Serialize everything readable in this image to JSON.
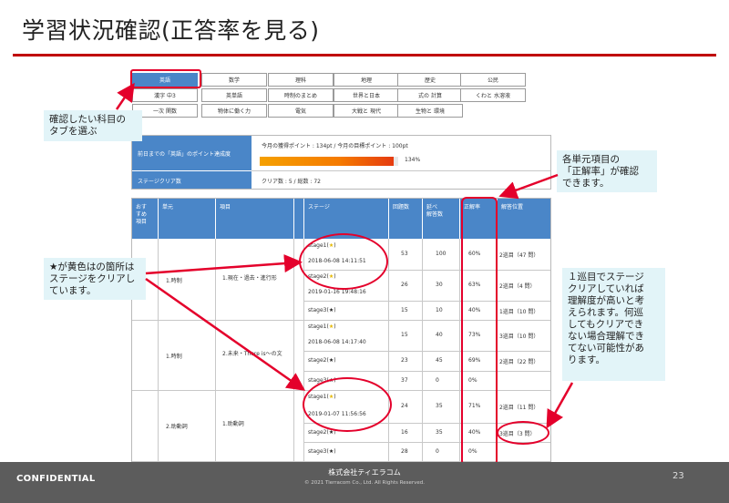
{
  "slide": {
    "title": "学習状況確認(正答率を見る)",
    "confidential": "CONFIDENTIAL",
    "company": "株式会社ティエラコム",
    "copyright": "© 2021 Tierracom Co., Ltd. All Rights Reserved.",
    "page_number": "23"
  },
  "tabs": {
    "row1": [
      "英語",
      "数学",
      "理科",
      "地理",
      "歴史",
      "公民"
    ],
    "row2": [
      "漢字 中3",
      "英単語",
      "時制のまとめ",
      "世界と日本",
      "式の 計算",
      "くわと 水溶液"
    ],
    "row3": [
      "一次 関数",
      "物体に働く力",
      "電気",
      "大戦と 現代",
      "生物と 環境"
    ],
    "active": "英語"
  },
  "points": {
    "label": "前日までの「英語」のポイント達成度",
    "monthly_text": "今月の獲得ポイント : 134pt  /  今月の目標ポイント : 100pt",
    "progress_text": "134%",
    "progress_value": 134,
    "clear_label": "ステージクリア数",
    "clear_text": "クリア数 : 5 / 総数 : 72"
  },
  "table": {
    "headers": {
      "recommend": "おす\nすめ\n項目",
      "unit": "単元",
      "item": "項目",
      "stage": "ステージ",
      "count": "回題数",
      "total": "延べ\n解答数",
      "rate": "正解率",
      "position": "解答位置"
    },
    "groups": [
      {
        "unit": "1.時制",
        "item": "1.現在・過去・進行形",
        "rows": [
          {
            "stage": "stage1(",
            "star": "★",
            "date": "2018-06-08 14:11:51",
            "count": "53",
            "total": "100",
            "rate": "60%",
            "position": "2巡目（47 問）"
          },
          {
            "stage": "stage2(",
            "star": "★",
            "date": "2019-01-16 19:48:16",
            "count": "26",
            "total": "30",
            "rate": "63%",
            "position": "2巡目（4 問）"
          },
          {
            "stage": "stage3(",
            "star": "★",
            "date": "",
            "count": "15",
            "total": "10",
            "rate": "40%",
            "position": "1巡目（10 問）"
          }
        ]
      },
      {
        "unit": "1.時制",
        "item": "2.未来・There is～の文",
        "rows": [
          {
            "stage": "stage1(",
            "star": "★",
            "date": "2018-06-08 14:17:40",
            "count": "15",
            "total": "40",
            "rate": "73%",
            "position": "3巡目（10 問）"
          },
          {
            "stage": "stage2(",
            "star": "★",
            "date": "",
            "count": "23",
            "total": "45",
            "rate": "69%",
            "position": "2巡目（22 問）"
          },
          {
            "stage": "stage3(",
            "star": "★",
            "date": "",
            "count": "37",
            "total": "0",
            "rate": "0%",
            "position": ""
          }
        ]
      },
      {
        "unit": "2.助動詞",
        "item": "1.助動詞",
        "rows": [
          {
            "stage": "stage1(",
            "star": "★",
            "date": "2019-01-07 11:56:56",
            "count": "24",
            "total": "35",
            "rate": "71%",
            "position": "2巡目（11 問）"
          },
          {
            "stage": "stage2(",
            "star": "★",
            "date": "",
            "count": "16",
            "total": "35",
            "rate": "40%",
            "position": "3巡目（3 問）"
          },
          {
            "stage": "stage3(",
            "star": "★",
            "date": "",
            "count": "28",
            "total": "0",
            "rate": "0%",
            "position": ""
          }
        ]
      }
    ],
    "close_paren": ")"
  },
  "callouts": {
    "tab_select": "確認したい科目の\nタブを選ぶ",
    "rate_check": "各単元項目の\n「正解率」が確認\nできます。",
    "star_yellow": "★が黄色はの箇所は\nステージをクリアし\nています。",
    "round_note": "１巡目でステージ\nクリアしていれば\n理解度が高いと考\nえられます。何巡\nしてもクリアでき\nない場合理解でき\nてない可能性があ\nります。"
  },
  "colors": {
    "accent_red": "#e4002b",
    "header_blue": "#4a86c8",
    "star_yellow": "#e6b800",
    "callout_bg": "#e2f4f8"
  }
}
